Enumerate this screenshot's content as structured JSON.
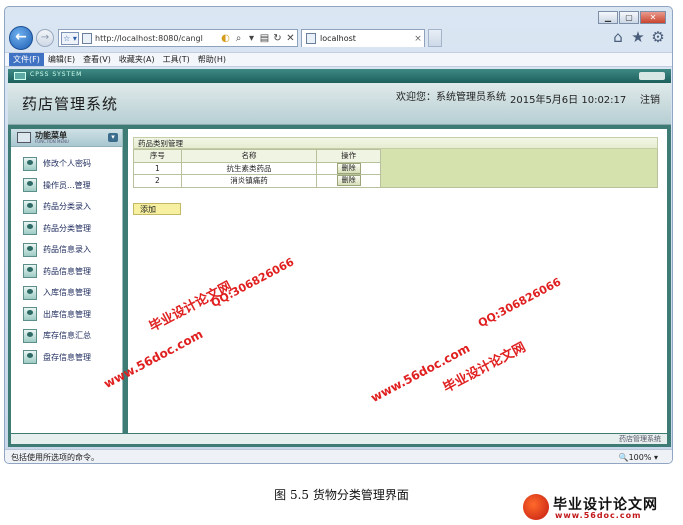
{
  "browser": {
    "url": "http://localhost:8080/cangl",
    "tab_label": "localhost",
    "fav_btn": "☆ ▾",
    "menu": [
      "文件(F)",
      "编辑(E)",
      "查看(V)",
      "收藏夹(A)",
      "工具(T)",
      "帮助(H)"
    ],
    "status_text": "包括使用所选项的命令。",
    "zoom": "🔍100%  ▾"
  },
  "sys_strip": {
    "label": "CPSS SYSTEM"
  },
  "header": {
    "title": "药店管理系统",
    "welcome": "欢迎您：系统管理员系统",
    "datetime": "2015年5月6日  10:02:17",
    "logout": "注销"
  },
  "sidebar": {
    "heading": "功能菜单",
    "subheading": "FUNCTION MENU",
    "items": [
      "修改个人密码",
      "操作员...管理",
      "药品分类录入",
      "药品分类管理",
      "药品信息录入",
      "药品信息管理",
      "入库信息管理",
      "出库信息管理",
      "库存信息汇总",
      "盘存信息管理"
    ]
  },
  "main": {
    "caption": "药品类别管理",
    "columns": [
      "序号",
      "名称",
      "操作"
    ],
    "rows": [
      {
        "no": "1",
        "name": "抗生素类药品",
        "op": "删除"
      },
      {
        "no": "2",
        "name": "消炎镇痛药",
        "op": "删除"
      }
    ],
    "add_label": "添加",
    "footer": "药店管理系统"
  },
  "watermarks": {
    "a": "毕业设计论文网",
    "b": "www.56doc.com",
    "c": "QQ:306826066"
  },
  "figure_caption": "图 5.5  货物分类管理界面",
  "brand": {
    "name": "毕业设计论文网",
    "url": "www.56doc.com"
  }
}
